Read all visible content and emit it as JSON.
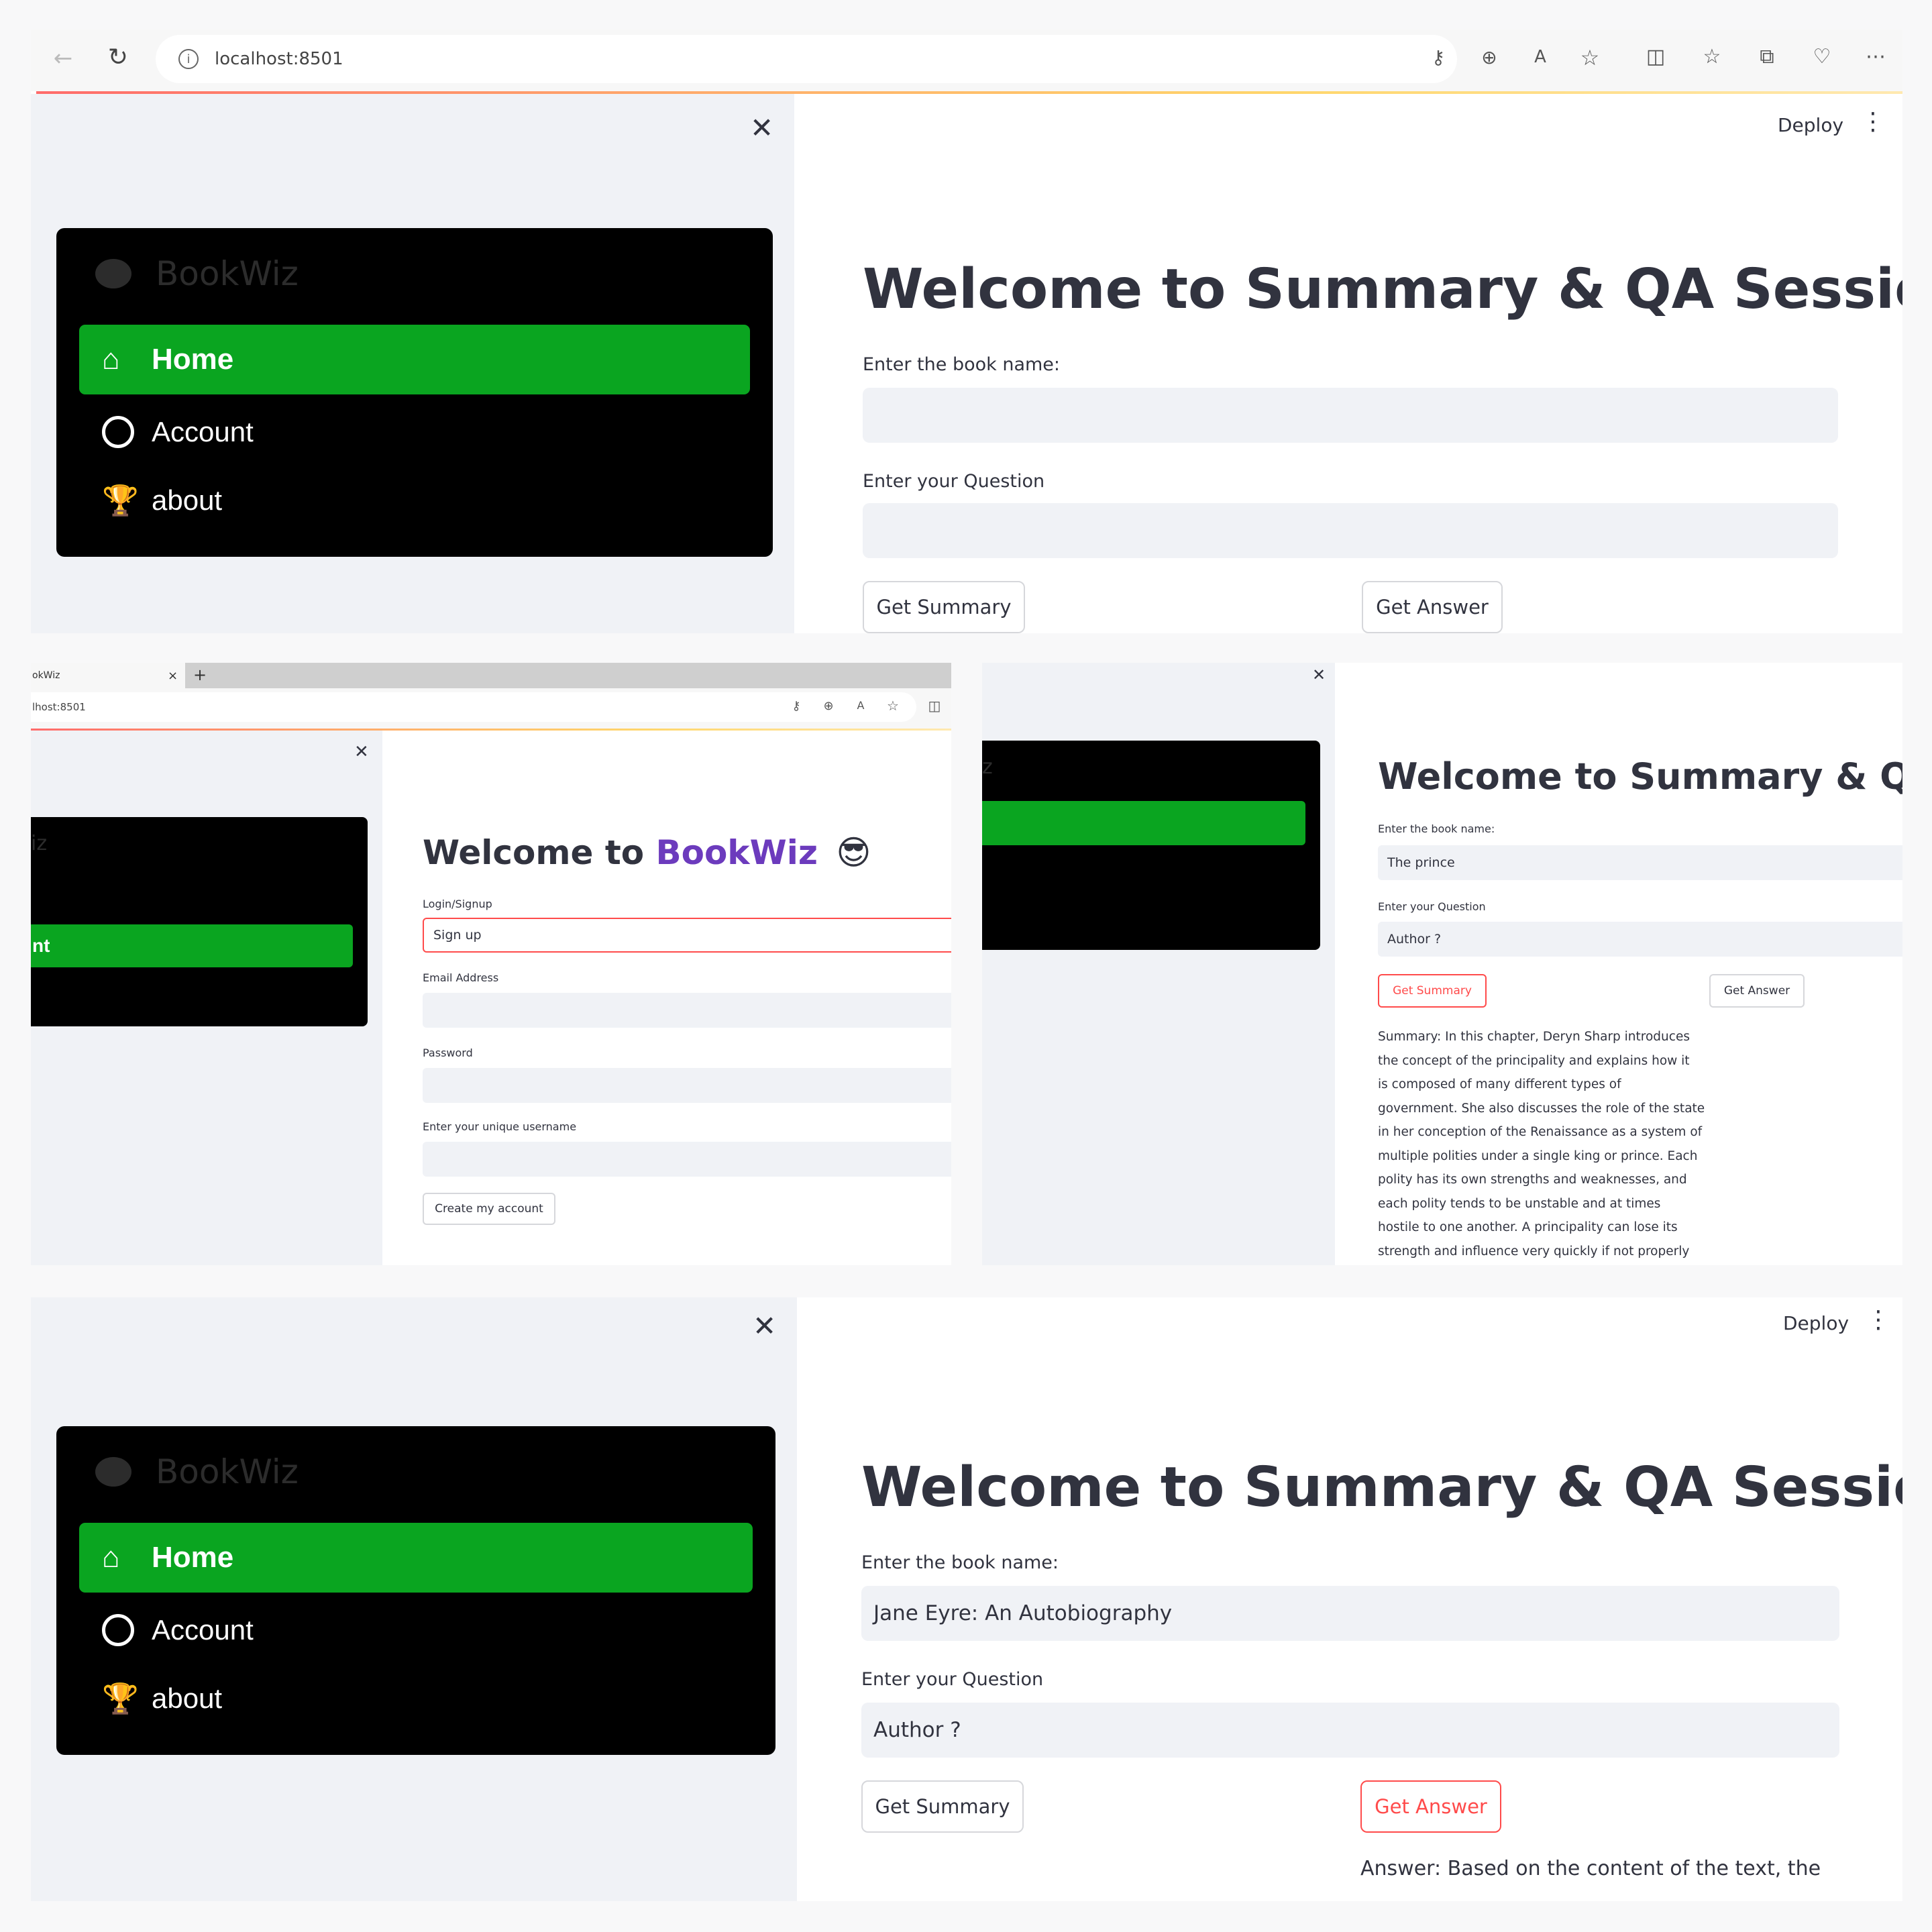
{
  "panel1": {
    "address": "localhost:8501",
    "deploy": "Deploy",
    "brand": "BookWiz",
    "nav": [
      "Home",
      "Account",
      "about"
    ],
    "title": "Welcome to Summary & QA Session",
    "book_label": "Enter the book name:",
    "question_label": "Enter your Question",
    "summary_btn": "Get Summary",
    "answer_btn": "Get Answer"
  },
  "panel2": {
    "tab_title": "okWiz",
    "address": "lhost:8501",
    "brand": "iz",
    "nav_active": "nt",
    "title_prefix": "Welcome to ",
    "title_brand": "BookWiz",
    "title_emoji": "😎",
    "login_label": "Login/Signup",
    "login_value": "Sign up",
    "email_label": "Email Address",
    "password_label": "Password",
    "username_label": "Enter your unique username",
    "create_btn": "Create my account"
  },
  "panel3": {
    "brand": "z",
    "title": "Welcome to Summary & QA Se",
    "book_label": "Enter the book name:",
    "book_value": "The prince",
    "question_label": "Enter your Question",
    "question_value": "Author ?",
    "summary_btn": "Get Summary",
    "answer_btn": "Get Answer",
    "summary_lines": [
      "Summary: In this chapter, Deryn Sharp introduces",
      "the concept of the principality and explains how it",
      "is composed of many different types of",
      "government. She also discusses the role of the state",
      "in her conception of the Renaissance as a system of",
      "multiple polities under a single king or prince. Each",
      "polity has its own strengths and weaknesses, and",
      "each polity tends to be unstable and at times",
      "hostile to one another. A principality can lose its",
      "strength and influence very quickly if not properly"
    ]
  },
  "panel4": {
    "deploy": "Deploy",
    "brand": "BookWiz",
    "nav": [
      "Home",
      "Account",
      "about"
    ],
    "title": "Welcome to Summary & QA Session",
    "book_label": "Enter the book name:",
    "book_value": "Jane Eyre: An Autobiography",
    "question_label": "Enter your Question",
    "question_value": "Author ?",
    "summary_btn": "Get Summary",
    "answer_btn": "Get Answer",
    "answer_text": "Answer: Based on the content of the text, the"
  },
  "colors": {
    "active_green": "#0aa520",
    "accent_red": "#ff4b4b",
    "brand_purple": "#6c3bbd",
    "nav_bg": "#000000",
    "sidebar_bg": "#f0f2f6"
  }
}
